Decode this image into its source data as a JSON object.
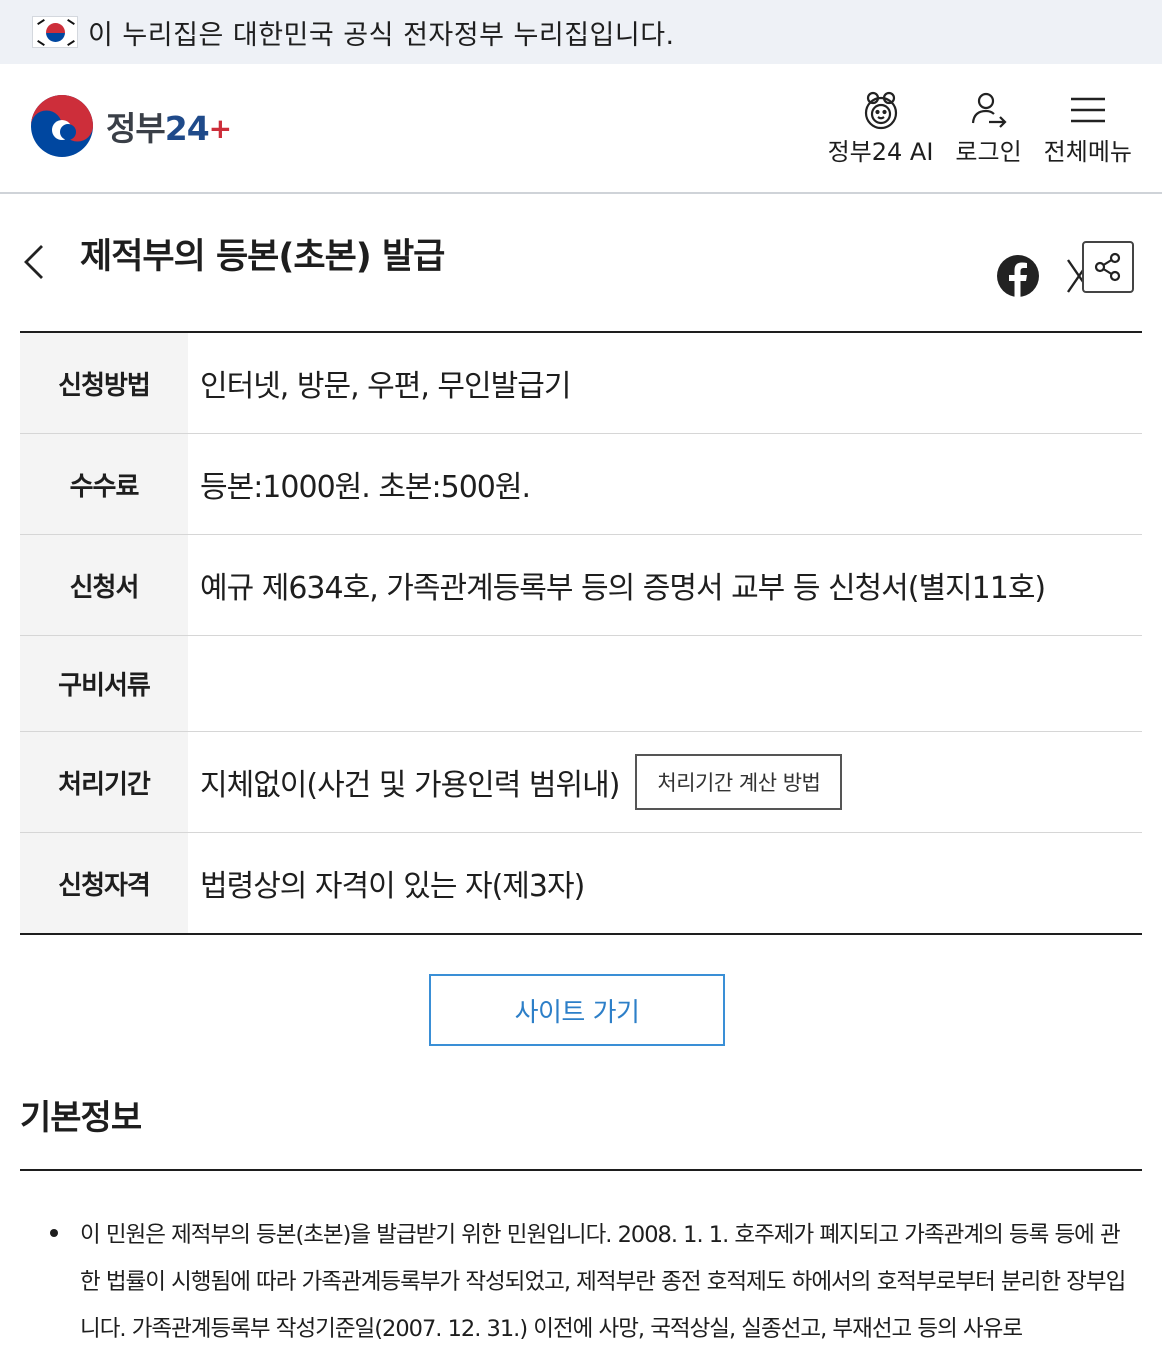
{
  "gov_banner": {
    "text": "이 누리집은 대한민국 공식 전자정부 누리집입니다."
  },
  "header": {
    "logo_text": "정부",
    "logo_num": "24",
    "utils": [
      {
        "label": "정부24 AI",
        "icon": "ai-mascot-icon"
      },
      {
        "label": "로그인",
        "icon": "user-login-icon"
      },
      {
        "label": "전체메뉴",
        "icon": "hamburger-menu-icon"
      }
    ]
  },
  "page": {
    "title": "제적부의 등본(초본) 발급"
  },
  "info_table": {
    "rows": [
      {
        "label": "신청방법",
        "value": "인터넷, 방문, 우편, 무인발급기"
      },
      {
        "label": "수수료",
        "value": "등본:1000원. 초본:500원."
      },
      {
        "label": "신청서",
        "value": "예규 제634호, 가족관계등록부 등의 증명서 교부 등 신청서(별지11호)"
      },
      {
        "label": "구비서류",
        "value": ""
      },
      {
        "label": "처리기간",
        "value": "지체없이(사건 및 가용인력 범위내)",
        "button": "처리기간 계산 방법"
      },
      {
        "label": "신청자격",
        "value": "법령상의 자격이 있는 자(제3자)"
      }
    ]
  },
  "site_button": "사이트 가기",
  "basic_info": {
    "title": "기본정보",
    "description": "이 민원은 제적부의 등본(초본)을 발급받기 위한 민원입니다. 2008. 1. 1. 호주제가 폐지되고 가족관계의 등록 등에 관한 법률이 시행됨에 따라 가족관계등록부가 작성되었고, 제적부란 종전 호적제도 하에서의 호적부로부터 분리한 장부입니다. 가족관계등록부 작성기준일(2007. 12. 31.) 이전에 사망, 국적상실, 실종선고, 부재선고 등의 사유로"
  },
  "colors": {
    "banner_bg": "#eef1f6",
    "th_bg": "#f4f4f4",
    "accent_blue": "#2d7fc8",
    "logo_red": "#cd2e3a",
    "logo_blue": "#0047a0"
  }
}
